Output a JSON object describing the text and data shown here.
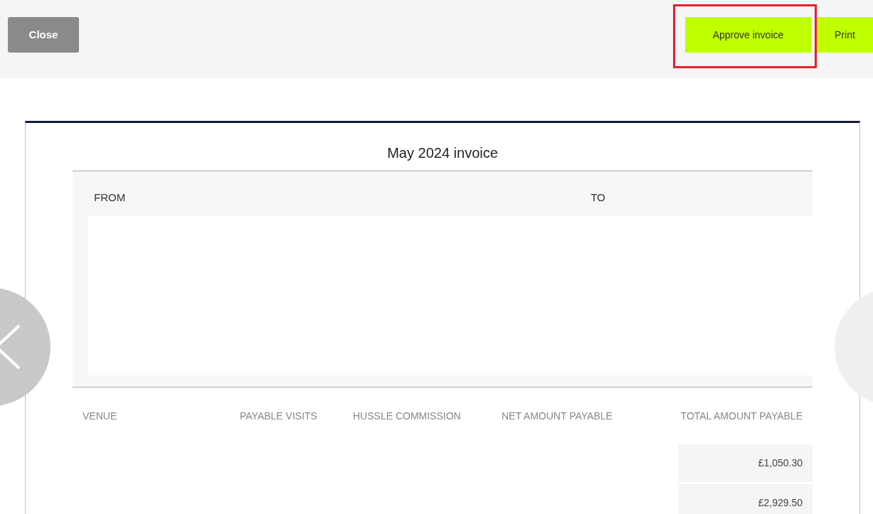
{
  "toolbar": {
    "close": "Close",
    "approve": "Approve invoice",
    "print": "Print",
    "approve_highlighted": true
  },
  "invoice": {
    "title": "May 2024 invoice",
    "from_label": "FROM",
    "to_label": "TO",
    "columns": [
      "VENUE",
      "PAYABLE VISITS",
      "HUSSLE COMMISSION",
      "NET AMOUNT PAYABLE",
      "TOTAL AMOUNT PAYABLE"
    ],
    "rows": [
      {
        "total": "£1,050.30"
      },
      {
        "total": "£2,929.50"
      }
    ]
  }
}
